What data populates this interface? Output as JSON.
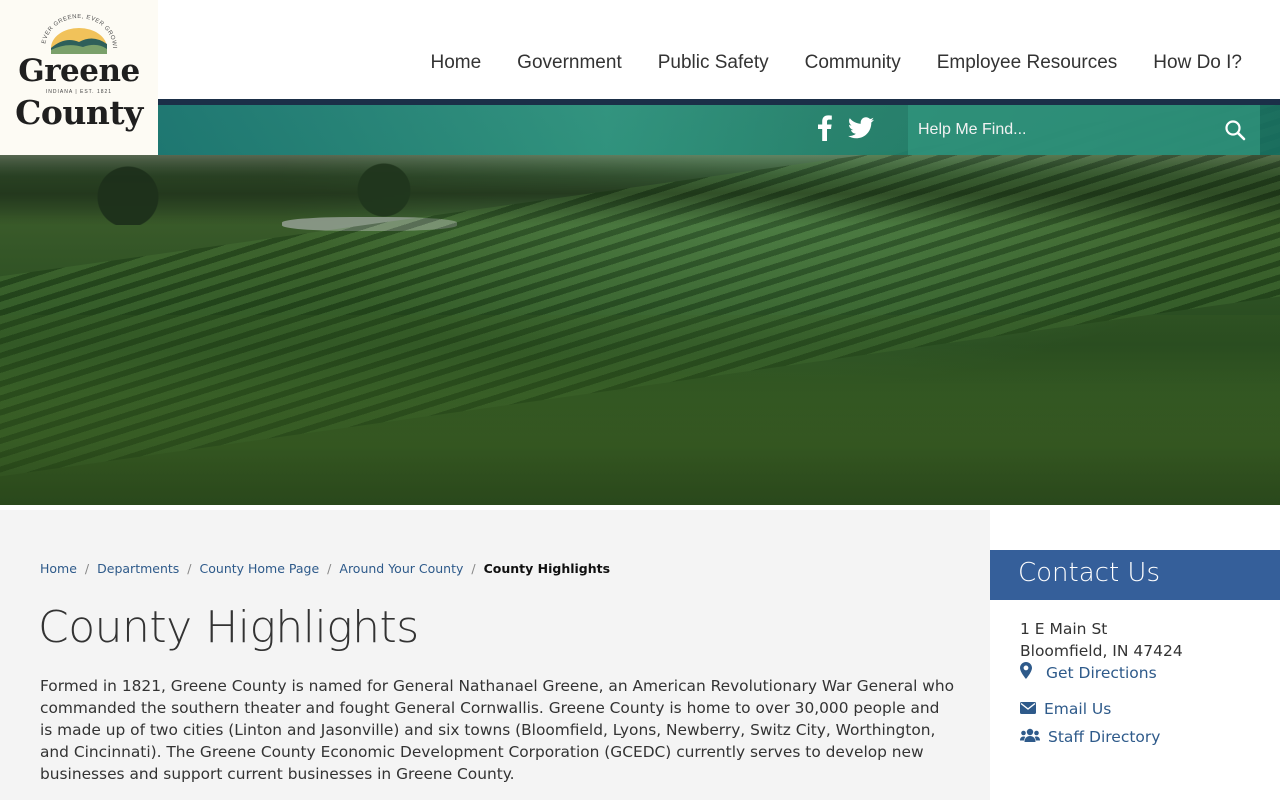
{
  "logo": {
    "arc_text": "EVER GREENE, EVER GROWING",
    "line1": "Greene",
    "sub": "INDIANA | EST. 1821",
    "line2": "County"
  },
  "nav": {
    "items": [
      "Home",
      "Government",
      "Public Safety",
      "Community",
      "Employee Resources",
      "How Do I?"
    ]
  },
  "social": {
    "icons": [
      "facebook-icon",
      "twitter-icon"
    ]
  },
  "search": {
    "placeholder": "Help Me Find..."
  },
  "breadcrumb": {
    "items": [
      "Home",
      "Departments",
      "County Home Page",
      "Around Your County"
    ],
    "current": "County Highlights",
    "separator": "/"
  },
  "page": {
    "title": "County Highlights",
    "body": "Formed in 1821, Greene County is named for General Nathanael Greene, an American Revolutionary War General who commanded the southern theater and fought General Cornwallis. Greene County is home to over 30,000 people and is made up of two cities (Linton and Jasonville) and six towns (Bloomfield, Lyons, Newberry, Switz City, Worthington, and Cincinnati). The Greene County Economic Development Corporation (GCEDC) currently serves to develop new businesses and support current businesses in Greene County."
  },
  "contact": {
    "heading": "Contact Us",
    "address_line1": "1 E Main St",
    "address_line2": "Bloomfield, IN 47424",
    "directions": "Get Directions",
    "email": "Email Us",
    "staff": "Staff Directory"
  },
  "colors": {
    "nav_line": "#1b2f48",
    "teal_bar": "#1f8a7c",
    "contact_header": "#355f9a",
    "link": "#2e5a8a"
  }
}
